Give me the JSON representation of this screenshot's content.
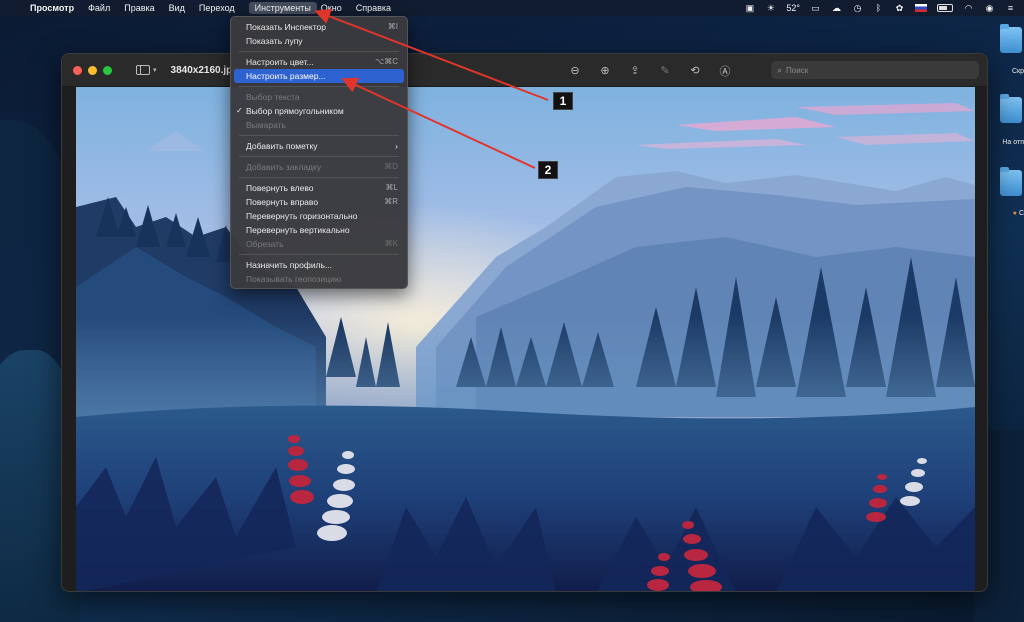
{
  "menubar": {
    "app_name": "Просмотр",
    "items": [
      "Файл",
      "Правка",
      "Вид",
      "Переход"
    ],
    "active_item": "Инструменты",
    "items_after": [
      "Окно",
      "Справка"
    ],
    "temperature": "52°"
  },
  "window": {
    "title": "3840x2160.jpg",
    "search_placeholder": "Поиск"
  },
  "tools_menu": {
    "items": [
      {
        "label": "Показать Инспектор",
        "shortcut": "⌘I",
        "disabled": false
      },
      {
        "label": "Показать лупу",
        "shortcut": "",
        "disabled": false
      },
      {
        "label": "Настроить цвет...",
        "shortcut": "⌥⌘C",
        "disabled": false
      },
      {
        "label": "Настроить размер...",
        "shortcut": "",
        "disabled": false,
        "highlighted": true
      },
      {
        "label": "Выбор текста",
        "shortcut": "",
        "disabled": true
      },
      {
        "label": "Выбор прямоугольником",
        "shortcut": "",
        "disabled": false,
        "checked": true
      },
      {
        "label": "Вымарать",
        "shortcut": "",
        "disabled": true
      },
      {
        "label": "Добавить пометку",
        "shortcut": "",
        "disabled": false,
        "submenu": true
      },
      {
        "label": "Добавить закладку",
        "shortcut": "⌘D",
        "disabled": true
      },
      {
        "label": "Повернуть влево",
        "shortcut": "⌘L",
        "disabled": false
      },
      {
        "label": "Повернуть вправо",
        "shortcut": "⌘R",
        "disabled": false
      },
      {
        "label": "Перевернуть горизонтально",
        "shortcut": "",
        "disabled": false
      },
      {
        "label": "Перевернуть вертикально",
        "shortcut": "",
        "disabled": false
      },
      {
        "label": "Обрезать",
        "shortcut": "⌘K",
        "disabled": true
      },
      {
        "label": "Назначить профиль...",
        "shortcut": "",
        "disabled": false
      },
      {
        "label": "Показывать геопозицию",
        "shortcut": "",
        "disabled": true
      }
    ]
  },
  "desktop": {
    "labels": [
      "Скр",
      "На отп",
      "С"
    ]
  },
  "annotations": {
    "badge_1": "1",
    "badge_2": "2",
    "arrow_color": "#e0352b"
  }
}
